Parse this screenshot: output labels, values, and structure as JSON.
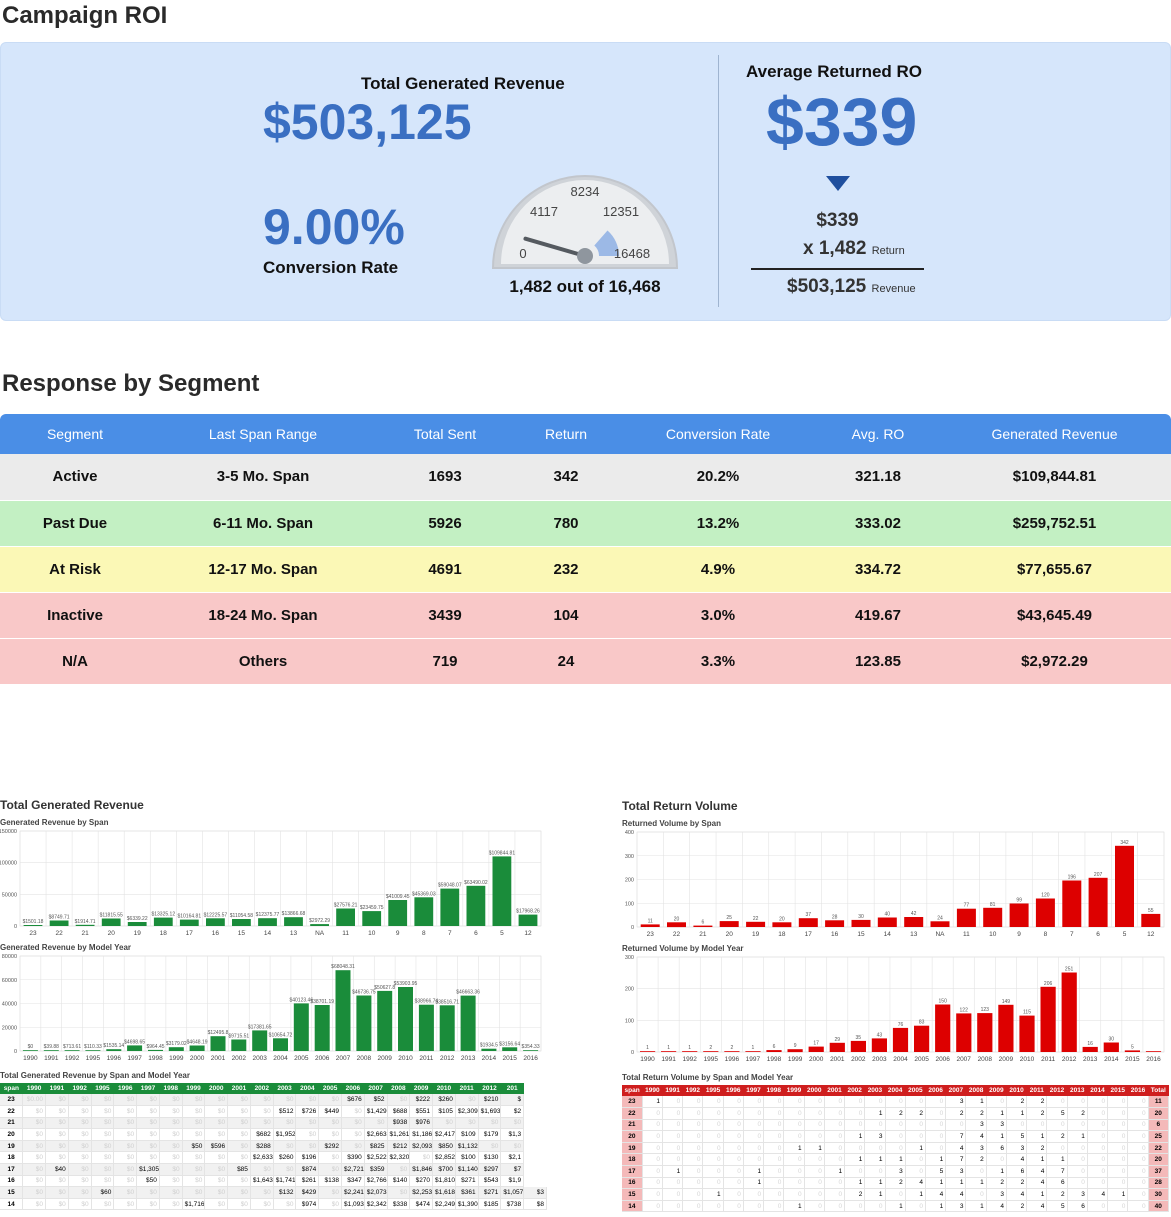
{
  "roi": {
    "title": "Campaign ROI",
    "revenue_label": "Total Generated Revenue",
    "revenue_value": "$503,125",
    "conversion_value": "9.00%",
    "conversion_label": "Conversion Rate",
    "gauge": {
      "min": "0",
      "mid_left": "4117",
      "mid": "8234",
      "mid_right": "12351",
      "max": "16468",
      "value": 1482,
      "total": 16468
    },
    "gauge_caption": "1,482 out of 16,468",
    "avg_label": "Average Returned RO",
    "avg_value": "$339",
    "calc_line1": "$339",
    "calc_line2": "x 1,482",
    "calc_line2_unit": "Return",
    "calc_line3": "$503,125",
    "calc_line3_unit": "Revenue"
  },
  "segment": {
    "title": "Response by Segment",
    "headers": [
      "Segment",
      "Last Span Range",
      "Total Sent",
      "Return",
      "Conversion Rate",
      "Avg. RO",
      "Generated Revenue"
    ],
    "rows": [
      {
        "bg": "#ebebeb",
        "cells": [
          "Active",
          "3-5 Mo. Span",
          "1693",
          "342",
          "20.2%",
          "321.18",
          "$109,844.81"
        ]
      },
      {
        "bg": "#c3f0c3",
        "cells": [
          "Past Due",
          "6-11 Mo. Span",
          "5926",
          "780",
          "13.2%",
          "333.02",
          "$259,752.51"
        ]
      },
      {
        "bg": "#fbf8b6",
        "cells": [
          "At Risk",
          "12-17 Mo. Span",
          "4691",
          "232",
          "4.9%",
          "334.72",
          "$77,655.67"
        ]
      },
      {
        "bg": "#f9c8c8",
        "cells": [
          "Inactive",
          "18-24 Mo. Span",
          "3439",
          "104",
          "3.0%",
          "419.67",
          "$43,645.49"
        ]
      },
      {
        "bg": "#f9c8c8",
        "cells": [
          "N/A",
          "Others",
          "719",
          "24",
          "3.3%",
          "123.85",
          "$2,972.29"
        ]
      }
    ]
  },
  "revenue_charts": {
    "title": "Total Generated Revenue",
    "span_subtitle": "Generated Revenue by Span",
    "year_subtitle": "Generated Revenue by Model Year",
    "table_title": "Total Generated Revenue by Span and Model Year"
  },
  "return_charts": {
    "title": "Total Return Volume",
    "span_subtitle": "Returned Volume by Span",
    "year_subtitle": "Returned Volume by Model Year",
    "table_title": "Total Return Volume by Span and Model Year"
  },
  "chart_data": [
    {
      "id": "rev-span",
      "type": "bar",
      "color": "#1a8c3a",
      "yticks": [
        "150000",
        "100000",
        "50000",
        "0"
      ],
      "ylim": [
        0,
        150000
      ],
      "categories": [
        "23",
        "22",
        "21",
        "20",
        "19",
        "18",
        "17",
        "16",
        "15",
        "14",
        "13",
        "NA",
        "11",
        "10",
        "9",
        "8",
        "7",
        "6",
        "5",
        "12"
      ],
      "values": [
        1501.18,
        8749.71,
        1914.71,
        11815.55,
        6339.22,
        13325.12,
        10164.81,
        12225.57,
        11054.58,
        12375.77,
        13866.68,
        2972.29,
        27576.21,
        23459.75,
        41009.45,
        45369.03,
        59048.07,
        63490.02,
        109844.81,
        17968.26
      ],
      "labels": [
        "$1501.18",
        "$8749.71",
        "$1914.71",
        "$11815.55",
        "$6339.22",
        "$13325.12",
        "$10164.81",
        "$12225.57",
        "$11054.58",
        "$12375.77",
        "$13866.68",
        "$2972.29",
        "$27576.21",
        "$23459.75",
        "$41009.45",
        "$45369.03",
        "$59048.07",
        "$63490.02",
        "$109844.81",
        "$17968.26"
      ]
    },
    {
      "id": "rev-year",
      "type": "bar",
      "color": "#1a8c3a",
      "yticks": [
        "80000",
        "60000",
        "40000",
        "20000",
        "0"
      ],
      "ylim": [
        0,
        80000
      ],
      "categories": [
        "1990",
        "1991",
        "1992",
        "1995",
        "1996",
        "1997",
        "1998",
        "1999",
        "2000",
        "2001",
        "2002",
        "2003",
        "2004",
        "2005",
        "2006",
        "2007",
        "2008",
        "2009",
        "2010",
        "2011",
        "2012",
        "2013",
        "2014",
        "2015",
        "2016"
      ],
      "values": [
        0,
        39.88,
        713.61,
        110.33,
        1535.14,
        4698.65,
        964.45,
        3179.02,
        4648.19,
        12495.8,
        9715.51,
        17381.65,
        10654.72,
        40123.46,
        38701.19,
        68048.31,
        46736.75,
        50627.8,
        53903.95,
        38966.74,
        38516.71,
        46663.36,
        1934.5,
        3156.64,
        354.33
      ],
      "labels": [
        "$0",
        "$39.88",
        "$713.61",
        "$110.33",
        "$1535.14",
        "$4698.65",
        "$964.45",
        "$3179.02",
        "$4648.19",
        "$12495.8",
        "$9715.51",
        "$17381.65",
        "$10654.72",
        "$40123.46",
        "$38701.19",
        "$68048.31",
        "$46736.75",
        "$50627.8",
        "$53903.95",
        "$38966.74",
        "$38516.71",
        "$46663.36",
        "$1934.5",
        "$3156.64",
        "$354.33"
      ]
    },
    {
      "id": "ret-span",
      "type": "bar",
      "color": "#dd0000",
      "yticks": [
        "400",
        "300",
        "200",
        "100",
        "0"
      ],
      "ylim": [
        0,
        400
      ],
      "categories": [
        "23",
        "22",
        "21",
        "20",
        "19",
        "18",
        "17",
        "16",
        "15",
        "14",
        "13",
        "NA",
        "11",
        "10",
        "9",
        "8",
        "7",
        "6",
        "5",
        "12"
      ],
      "values": [
        11,
        20,
        6,
        25,
        22,
        20,
        37,
        28,
        30,
        40,
        42,
        24,
        77,
        81,
        99,
        120,
        196,
        207,
        342,
        55
      ],
      "labels": [
        "11",
        "20",
        "6",
        "25",
        "22",
        "20",
        "37",
        "28",
        "30",
        "40",
        "42",
        "24",
        "77",
        "81",
        "99",
        "120",
        "196",
        "207",
        "342",
        "55"
      ]
    },
    {
      "id": "ret-year",
      "type": "bar",
      "color": "#dd0000",
      "yticks": [
        "300",
        "200",
        "100",
        "0"
      ],
      "ylim": [
        0,
        300
      ],
      "categories": [
        "1990",
        "1991",
        "1992",
        "1995",
        "1996",
        "1997",
        "1998",
        "1999",
        "2000",
        "2001",
        "2002",
        "2003",
        "2004",
        "2005",
        "2006",
        "2007",
        "2008",
        "2009",
        "2010",
        "2011",
        "2012",
        "2013",
        "2014",
        "2015",
        "2016"
      ],
      "values": [
        1,
        1,
        1,
        2,
        2,
        1,
        6,
        9,
        17,
        29,
        35,
        43,
        76,
        83,
        150,
        122,
        123,
        149,
        115,
        206,
        251,
        16,
        30,
        5,
        0
      ],
      "labels": [
        "1",
        "1",
        "1",
        "2",
        "2",
        "1",
        "6",
        "9",
        "17",
        "29",
        "35",
        "43",
        "76",
        "83",
        "150",
        "122",
        "123",
        "149",
        "115",
        "206",
        "251",
        "16",
        "30",
        "5",
        ""
      ]
    }
  ],
  "rev_table": {
    "headers": [
      "span",
      "1990",
      "1991",
      "1992",
      "1995",
      "1996",
      "1997",
      "1998",
      "1999",
      "2000",
      "2001",
      "2002",
      "2003",
      "2004",
      "2005",
      "2006",
      "2007",
      "2008",
      "2009",
      "2010",
      "2011",
      "2012",
      "201"
    ],
    "rows": [
      [
        "23",
        "$0.00",
        "$0",
        "$0",
        "$0",
        "$0",
        "$0",
        "$0",
        "$0",
        "$0",
        "$0",
        "$0",
        "$0",
        "$0",
        "$0",
        "$676",
        "$52",
        "$0",
        "$222",
        "$260",
        "$0",
        "$210",
        "$"
      ],
      [
        "22",
        "$0",
        "$0",
        "$0",
        "$0",
        "$0",
        "$0",
        "$0",
        "$0",
        "$0",
        "$0",
        "$0",
        "$512",
        "$726",
        "$449",
        "$0",
        "$1,429",
        "$688",
        "$551",
        "$105",
        "$2,309",
        "$1,693",
        "$2"
      ],
      [
        "21",
        "$0",
        "$0",
        "$0",
        "$0",
        "$0",
        "$0",
        "$0",
        "$0",
        "$0",
        "$0",
        "$0",
        "$0",
        "$0",
        "$0",
        "$0",
        "$0",
        "$938",
        "$976",
        "$0",
        "$0",
        "$0",
        "$0"
      ],
      [
        "20",
        "$0",
        "$0",
        "$0",
        "$0",
        "$0",
        "$0",
        "$0",
        "$0",
        "$0",
        "$0",
        "$682",
        "$1,952",
        "$0",
        "$0",
        "$0",
        "$2,663",
        "$1,261",
        "$1,186",
        "$2,417",
        "$109",
        "$179",
        "$1,3"
      ],
      [
        "19",
        "$0",
        "$0",
        "$0",
        "$0",
        "$0",
        "$0",
        "$0",
        "$50",
        "$596",
        "$0",
        "$288",
        "$0",
        "$0",
        "$292",
        "$0",
        "$825",
        "$212",
        "$2,093",
        "$850",
        "$1,132",
        "$0",
        "$0"
      ],
      [
        "18",
        "$0",
        "$0",
        "$0",
        "$0",
        "$0",
        "$0",
        "$0",
        "$0",
        "$0",
        "$0",
        "$2,633",
        "$260",
        "$196",
        "$0",
        "$390",
        "$2,522",
        "$2,320",
        "$0",
        "$2,852",
        "$100",
        "$130",
        "$2,1"
      ],
      [
        "17",
        "$0",
        "$40",
        "$0",
        "$0",
        "$0",
        "$1,305",
        "$0",
        "$0",
        "$0",
        "$85",
        "$0",
        "$0",
        "$874",
        "$0",
        "$2,721",
        "$359",
        "$0",
        "$1,846",
        "$700",
        "$1,140",
        "$297",
        "$7"
      ],
      [
        "16",
        "$0",
        "$0",
        "$0",
        "$0",
        "$0",
        "$50",
        "$0",
        "$0",
        "$0",
        "$0",
        "$1,643",
        "$1,741",
        "$261",
        "$138",
        "$347",
        "$2,766",
        "$140",
        "$270",
        "$1,810",
        "$271",
        "$543",
        "$1,9"
      ],
      [
        "15",
        "$0",
        "$0",
        "$0",
        "$60",
        "$0",
        "$0",
        "$0",
        "$0",
        "$0",
        "$0",
        "$0",
        "$132",
        "$429",
        "$0",
        "$2,241",
        "$2,073",
        "$0",
        "$2,253",
        "$1,618",
        "$361",
        "$271",
        "$1,057",
        "$3"
      ],
      [
        "14",
        "$0",
        "$0",
        "$0",
        "$0",
        "$0",
        "$0",
        "$0",
        "$1,716",
        "$0",
        "$0",
        "$0",
        "$0",
        "$974",
        "$0",
        "$1,093",
        "$2,342",
        "$338",
        "$474",
        "$2,249",
        "$1,390",
        "$185",
        "$738",
        "$8"
      ]
    ]
  },
  "ret_table": {
    "headers": [
      "span",
      "1990",
      "1991",
      "1992",
      "1995",
      "1996",
      "1997",
      "1998",
      "1999",
      "2000",
      "2001",
      "2002",
      "2003",
      "2004",
      "2005",
      "2006",
      "2007",
      "2008",
      "2009",
      "2010",
      "2011",
      "2012",
      "2013",
      "2014",
      "2015",
      "2016",
      "Total"
    ],
    "rows": [
      [
        "23",
        "1",
        "0",
        "0",
        "0",
        "0",
        "0",
        "0",
        "0",
        "0",
        "0",
        "0",
        "0",
        "0",
        "0",
        "0",
        "3",
        "1",
        "0",
        "2",
        "2",
        "0",
        "0",
        "0",
        "0",
        "0",
        "11"
      ],
      [
        "22",
        "0",
        "0",
        "0",
        "0",
        "0",
        "0",
        "0",
        "0",
        "0",
        "0",
        "0",
        "1",
        "2",
        "2",
        "0",
        "2",
        "2",
        "1",
        "1",
        "2",
        "5",
        "2",
        "0",
        "0",
        "0",
        "20"
      ],
      [
        "21",
        "0",
        "0",
        "0",
        "0",
        "0",
        "0",
        "0",
        "0",
        "0",
        "0",
        "0",
        "0",
        "0",
        "0",
        "0",
        "0",
        "3",
        "3",
        "0",
        "0",
        "0",
        "0",
        "0",
        "0",
        "0",
        "6"
      ],
      [
        "20",
        "0",
        "0",
        "0",
        "0",
        "0",
        "0",
        "0",
        "0",
        "0",
        "0",
        "1",
        "3",
        "0",
        "0",
        "0",
        "7",
        "4",
        "1",
        "5",
        "1",
        "2",
        "1",
        "0",
        "0",
        "0",
        "25"
      ],
      [
        "19",
        "0",
        "0",
        "0",
        "0",
        "0",
        "0",
        "0",
        "1",
        "1",
        "0",
        "0",
        "0",
        "0",
        "1",
        "0",
        "4",
        "3",
        "6",
        "3",
        "2",
        "0",
        "0",
        "0",
        "0",
        "0",
        "22"
      ],
      [
        "18",
        "0",
        "0",
        "0",
        "0",
        "0",
        "0",
        "0",
        "0",
        "0",
        "0",
        "1",
        "1",
        "1",
        "0",
        "1",
        "7",
        "2",
        "0",
        "4",
        "1",
        "1",
        "0",
        "0",
        "0",
        "0",
        "20"
      ],
      [
        "17",
        "0",
        "1",
        "0",
        "0",
        "0",
        "1",
        "0",
        "0",
        "0",
        "1",
        "0",
        "0",
        "3",
        "0",
        "5",
        "3",
        "0",
        "1",
        "6",
        "4",
        "7",
        "0",
        "0",
        "0",
        "0",
        "37"
      ],
      [
        "16",
        "0",
        "0",
        "0",
        "0",
        "0",
        "1",
        "0",
        "0",
        "0",
        "0",
        "1",
        "1",
        "2",
        "4",
        "1",
        "1",
        "1",
        "2",
        "2",
        "4",
        "6",
        "0",
        "0",
        "0",
        "0",
        "28"
      ],
      [
        "15",
        "0",
        "0",
        "0",
        "1",
        "0",
        "0",
        "0",
        "0",
        "0",
        "0",
        "2",
        "1",
        "0",
        "1",
        "4",
        "4",
        "0",
        "3",
        "4",
        "1",
        "2",
        "3",
        "4",
        "1",
        "0",
        "30"
      ],
      [
        "14",
        "0",
        "0",
        "0",
        "0",
        "0",
        "0",
        "0",
        "1",
        "0",
        "0",
        "0",
        "0",
        "1",
        "0",
        "1",
        "3",
        "1",
        "4",
        "2",
        "4",
        "5",
        "6",
        "0",
        "0",
        "0",
        "40"
      ]
    ]
  }
}
